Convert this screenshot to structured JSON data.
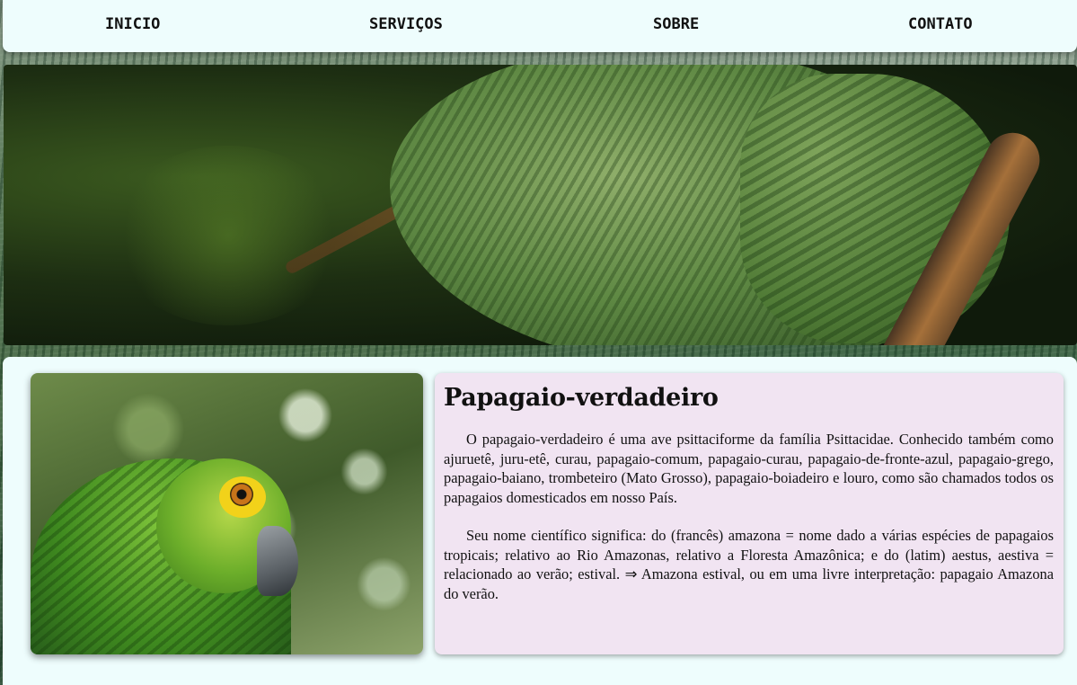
{
  "nav": {
    "items": [
      "INICIO",
      "SERVIÇOS",
      "SOBRE",
      "CONTATO"
    ]
  },
  "article": {
    "title": "Papagaio-verdadeiro",
    "paragraphs": [
      "O papagaio-verdadeiro é uma ave psittaciforme da família Psittacidae. Conhecido também como ajuruetê, juru-etê, curau, papagaio-comum, papagaio-curau, papagaio-de-fronte-azul, papagaio-grego, papagaio-baiano, trombeteiro (Mato Grosso), papagaio-boiadeiro e louro, como são chamados todos os papagaios domesticados em nosso País.",
      "Seu nome científico significa: do (francês) amazona = nome dado a várias espécies de papagaios tropicais; relativo ao Rio Amazonas, relativo a Floresta Amazônica; e do (latim) aestus, aestiva = relacionado ao verão; estival. ⇒ Amazona estival, ou em uma livre interpretação: papagaio Amazona do verão."
    ]
  },
  "colors": {
    "nav_background": "#eefdfd",
    "card_background": "#f1e4f2"
  }
}
